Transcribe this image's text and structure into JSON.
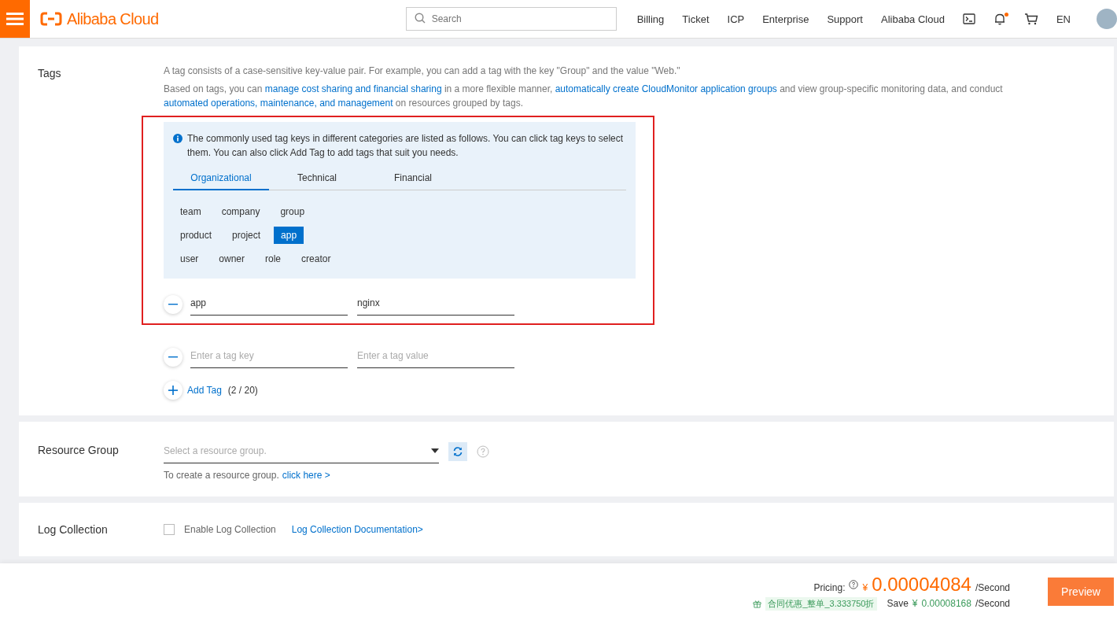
{
  "header": {
    "brand": "Alibaba Cloud",
    "search": {
      "placeholder": "Search"
    },
    "nav": [
      "Billing",
      "Ticket",
      "ICP",
      "Enterprise",
      "Support",
      "Alibaba Cloud"
    ],
    "notification_dot": true,
    "language": "EN"
  },
  "tags_section": {
    "label": "Tags",
    "paragraphs": [
      [
        {
          "text": "A tag consists of a case-sensitive key-value pair. For example, you can add a tag with the key \"Group\" and the value \"Web.\"",
          "link": false
        }
      ],
      [
        {
          "text": "Based on tags, you can ",
          "link": false
        },
        {
          "text": "manage cost sharing and financial sharing",
          "link": true
        },
        {
          "text": " in a more flexible manner, ",
          "link": false
        },
        {
          "text": "automatically create CloudMonitor application groups",
          "link": true
        },
        {
          "text": " and view group-specific monitoring data, and conduct ",
          "link": false
        },
        {
          "text": "automated operations, maintenance, and management",
          "link": true
        },
        {
          "text": " on resources grouped by tags.",
          "link": false
        }
      ]
    ],
    "info": "The commonly used tag keys in different categories are listed as follows. You can click tag keys to select them. You can also click Add Tag to add tags that suit you needs.",
    "tabs": [
      {
        "label": "Organizational",
        "selected": true
      },
      {
        "label": "Technical",
        "selected": false
      },
      {
        "label": "Financial",
        "selected": false
      }
    ],
    "key_rows": [
      [
        {
          "label": "team",
          "selected": false
        },
        {
          "label": "company",
          "selected": false
        },
        {
          "label": "group",
          "selected": false
        }
      ],
      [
        {
          "label": "product",
          "selected": false
        },
        {
          "label": "project",
          "selected": false
        },
        {
          "label": "app",
          "selected": true
        }
      ],
      [
        {
          "label": "user",
          "selected": false
        },
        {
          "label": "owner",
          "selected": false
        },
        {
          "label": "role",
          "selected": false
        },
        {
          "label": "creator",
          "selected": false
        }
      ]
    ],
    "tag_rows": [
      {
        "key": "app",
        "value": "nginx"
      },
      {
        "key": "",
        "value": "",
        "key_placeholder": "Enter a tag key",
        "value_placeholder": "Enter a tag value"
      }
    ],
    "add_tag": "Add Tag",
    "count": "(2 / 20)"
  },
  "resource_group": {
    "label": "Resource Group",
    "placeholder": "Select a resource group.",
    "hint": "To create a resource group.",
    "link": "click here >"
  },
  "log_collection": {
    "label": "Log Collection",
    "checkbox": {
      "label": "Enable Log Collection",
      "checked": false
    },
    "link": "Log Collection Documentation>"
  },
  "footer": {
    "pricing_label": "Pricing:",
    "currency": "¥",
    "price": "0.00004084",
    "unit": "/Second",
    "discount": "合同优惠_整单_3.333750折",
    "save_label": "Save",
    "save_currency": "¥",
    "save_amount": "0.00008168",
    "save_unit": "/Second",
    "button": "Preview"
  }
}
